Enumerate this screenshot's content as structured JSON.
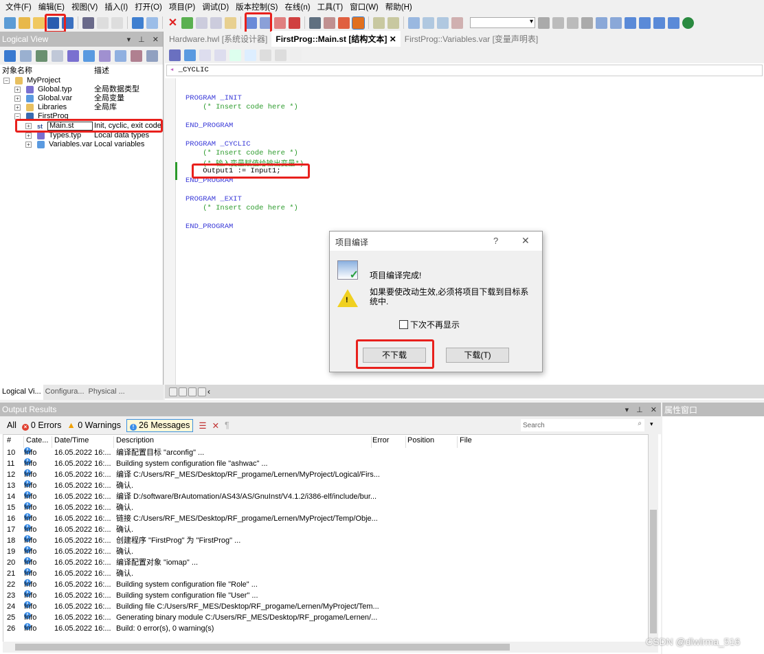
{
  "menu": [
    "文件(F)",
    "编辑(E)",
    "视图(V)",
    "插入(I)",
    "打开(O)",
    "项目(P)",
    "调试(D)",
    "版本控制(S)",
    "在线(n)",
    "工具(T)",
    "窗口(W)",
    "帮助(H)"
  ],
  "logical_view": {
    "title": "Logical View",
    "col_name": "对象名称",
    "col_desc": "描述",
    "tree": [
      {
        "name": "MyProject",
        "desc": ""
      },
      {
        "name": "Global.typ",
        "desc": "全局数据类型"
      },
      {
        "name": "Global.var",
        "desc": "全局变量"
      },
      {
        "name": "Libraries",
        "desc": "全局库"
      },
      {
        "name": "FirstProg",
        "desc": ""
      },
      {
        "name": "Main.st",
        "desc": "Init, cyclic, exit code"
      },
      {
        "name": "Types.typ",
        "desc": "Local data types"
      },
      {
        "name": "Variables.var",
        "desc": "Local variables"
      }
    ],
    "bottom_tabs": [
      "Logical Vi...",
      "Configura...",
      "Physical ..."
    ]
  },
  "editor": {
    "tabs": [
      "Hardware.hwl [系统设计器]",
      "FirstProg::Main.st [结构文本]",
      "FirstProg::Variables.var [变量声明表]"
    ],
    "active_tab": 1,
    "section": "_CYCLIC",
    "code": [
      {
        "t": "PROGRAM _INIT",
        "c": "kw"
      },
      {
        "t": "    (* Insert code here *)",
        "c": "cm"
      },
      {
        "t": "END_PROGRAM",
        "c": "kw"
      },
      {
        "t": "PROGRAM _CYCLIC",
        "c": "kw"
      },
      {
        "t": "    (* Insert code here *)",
        "c": "cm"
      },
      {
        "t": "    (* 输入变量赋值给输出变量*)",
        "c": "cm"
      },
      {
        "t": "    Output1 := Input1;",
        "c": ""
      },
      {
        "t": "END_PROGRAM",
        "c": "kw"
      },
      {
        "t": "PROGRAM _EXIT",
        "c": "kw"
      },
      {
        "t": "    (* Insert code here *)",
        "c": "cm"
      },
      {
        "t": "END_PROGRAM",
        "c": "kw"
      }
    ]
  },
  "dialog": {
    "title": "项目编译",
    "help": "?",
    "close": "✕",
    "message1": "项目编译完成!",
    "message2": "如果要使改动生效,必须将项目下载到目标系统中.",
    "checkbox_label": "下次不再显示",
    "checkbox_checked": false,
    "btn_no_download": "不下载",
    "btn_download": "下载(T)"
  },
  "output": {
    "title": "Output Results",
    "filter_all": "All",
    "errors": "0 Errors",
    "warnings": "0 Warnings",
    "messages": "26 Messages",
    "search_placeholder": "Search",
    "columns": [
      "#",
      "Cate...",
      "Date/Time",
      "Description",
      "Error",
      "Position",
      "File"
    ],
    "rows": [
      [
        "10",
        "Info",
        "16.05.2022 16:...",
        "编译配置目标 \"arconfig\" ..."
      ],
      [
        "11",
        "Info",
        "16.05.2022 16:...",
        "Building system configuration file \"ashwac\" ..."
      ],
      [
        "12",
        "Info",
        "16.05.2022 16:...",
        "编译 C:/Users/RF_MES/Desktop/RF_progame/Lernen/MyProject/Logical/Firs..."
      ],
      [
        "13",
        "Info",
        "16.05.2022 16:...",
        "确认."
      ],
      [
        "14",
        "Info",
        "16.05.2022 16:...",
        "编译 D:/software/BrAutomation/AS43/AS/GnuInst/V4.1.2/i386-elf/include/bur..."
      ],
      [
        "15",
        "Info",
        "16.05.2022 16:...",
        "确认."
      ],
      [
        "16",
        "Info",
        "16.05.2022 16:...",
        "链接 C:/Users/RF_MES/Desktop/RF_progame/Lernen/MyProject/Temp/Obje..."
      ],
      [
        "17",
        "Info",
        "16.05.2022 16:...",
        "确认."
      ],
      [
        "18",
        "Info",
        "16.05.2022 16:...",
        "创建程序 \"FirstProg\" 为 \"FirstProg\" ..."
      ],
      [
        "19",
        "Info",
        "16.05.2022 16:...",
        "确认."
      ],
      [
        "20",
        "Info",
        "16.05.2022 16:...",
        "编译配置对象 \"iomap\" ..."
      ],
      [
        "21",
        "Info",
        "16.05.2022 16:...",
        "确认."
      ],
      [
        "22",
        "Info",
        "16.05.2022 16:...",
        "Building system configuration file \"Role\" ..."
      ],
      [
        "23",
        "Info",
        "16.05.2022 16:...",
        "Building system configuration file \"User\" ..."
      ],
      [
        "24",
        "Info",
        "16.05.2022 16:...",
        "Building file C:/Users/RF_MES/Desktop/RF_progame/Lernen/MyProject/Tem..."
      ],
      [
        "25",
        "Info",
        "16.05.2022 16:...",
        "Generating binary module C:/Users/RF_MES/Desktop/RF_progame/Lernen/..."
      ],
      [
        "26",
        "Info",
        "16.05.2022 16:...",
        "Build: 0 error(s), 0 warning(s)"
      ]
    ]
  },
  "properties": {
    "title": "属性窗口"
  },
  "watermark": "CSDN @dlwlrma_516"
}
